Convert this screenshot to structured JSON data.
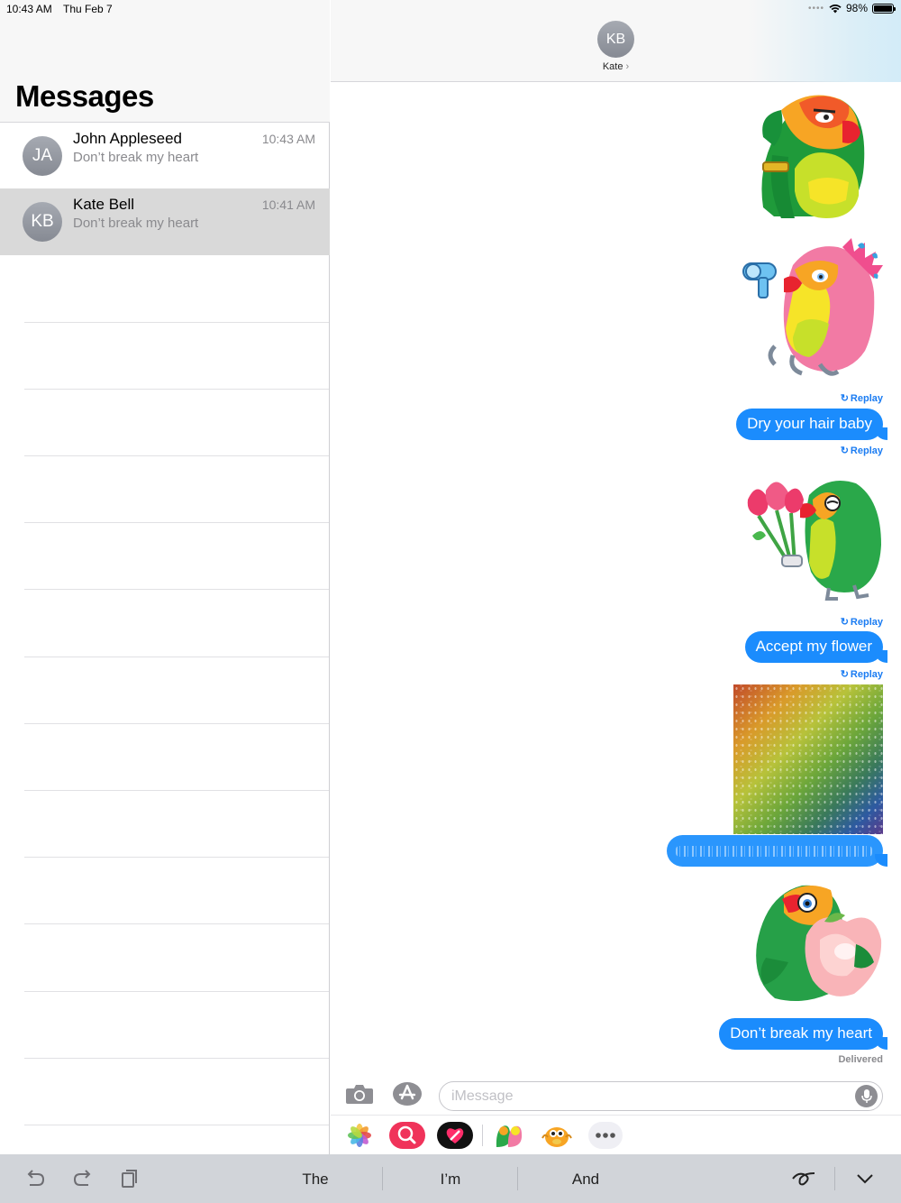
{
  "status_bar": {
    "time": "10:43 AM",
    "date": "Thu Feb 7",
    "battery": "98%",
    "battery_level": 0.98
  },
  "sidebar": {
    "title": "Messages",
    "conversations": [
      {
        "initials": "JA",
        "name": "John Appleseed",
        "preview": "Don’t break my heart",
        "time": "10:43 AM",
        "selected": false
      },
      {
        "initials": "KB",
        "name": "Kate Bell",
        "preview": "Don’t break my heart",
        "time": "10:41 AM",
        "selected": true
      }
    ]
  },
  "chat_header": {
    "initials": "KB",
    "name": "Kate",
    "chevron": "›"
  },
  "messages": {
    "replay_label": "Replay",
    "bubble1": "Dry your hair baby",
    "bubble2": "Accept my flower",
    "bubble3_hidden": "invisible ink message",
    "bubble4": "Don’t break my heart",
    "delivered": "Delivered",
    "stickers": [
      "parrot-saluting-sticker",
      "parrot-hairdryer-sticker",
      "parrot-flowers-sticker",
      "parrot-peach-heart-sticker"
    ]
  },
  "input": {
    "placeholder": "iMessage",
    "icons": [
      "camera-icon",
      "app-store-icon",
      "microphone-icon"
    ]
  },
  "app_drawer": {
    "apps": [
      "photos-app-icon",
      "images-search-app-icon",
      "digital-touch-app-icon",
      "parrot-sticker-pack-icon",
      "animoji-app-icon",
      "more-apps-icon"
    ],
    "more_label": "•••"
  },
  "keyboard_bar": {
    "suggestions": [
      "The",
      "I’m",
      "And"
    ],
    "tools": [
      "undo-icon",
      "redo-icon",
      "paste-icon",
      "handwriting-icon",
      "dismiss-keyboard-icon"
    ]
  },
  "colors": {
    "bubble_blue": "#1b8cfd",
    "link_blue": "#1b7cf2",
    "selected_row": "#d9d9d9",
    "keyboard_bar": "#d1d4d9"
  }
}
